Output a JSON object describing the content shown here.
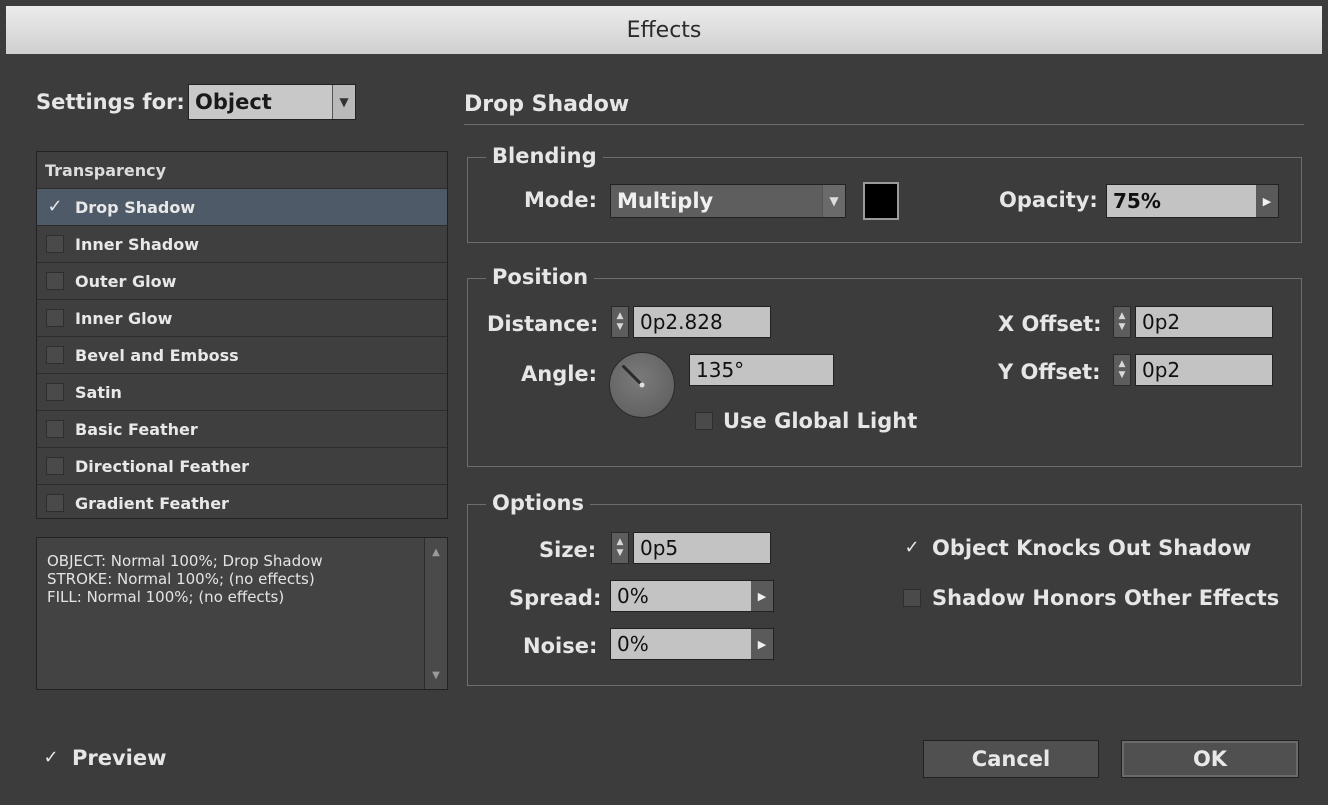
{
  "window": {
    "title": "Effects"
  },
  "settings_for": {
    "label": "Settings for:",
    "value": "Object"
  },
  "effects_list": {
    "header": "Transparency",
    "items": [
      {
        "label": "Drop Shadow",
        "checked": true,
        "selected": true
      },
      {
        "label": "Inner Shadow",
        "checked": false
      },
      {
        "label": "Outer Glow",
        "checked": false
      },
      {
        "label": "Inner Glow",
        "checked": false
      },
      {
        "label": "Bevel and Emboss",
        "checked": false
      },
      {
        "label": "Satin",
        "checked": false
      },
      {
        "label": "Basic Feather",
        "checked": false
      },
      {
        "label": "Directional Feather",
        "checked": false
      },
      {
        "label": "Gradient Feather",
        "checked": false
      }
    ]
  },
  "summary": {
    "lines": [
      "OBJECT: Normal 100%; Drop Shadow",
      "STROKE: Normal 100%; (no effects)",
      "FILL: Normal 100%; (no effects)"
    ]
  },
  "panel_title": "Drop Shadow",
  "blending": {
    "title": "Blending",
    "mode_label": "Mode:",
    "mode_value": "Multiply",
    "swatch_color": "#000000",
    "opacity_label": "Opacity:",
    "opacity_value": "75%"
  },
  "position": {
    "title": "Position",
    "distance_label": "Distance:",
    "distance_value": "0p2.828",
    "angle_label": "Angle:",
    "angle_value": "135°",
    "angle_degrees": 135,
    "use_global_light_label": "Use Global Light",
    "use_global_light_checked": false,
    "x_offset_label": "X Offset:",
    "x_offset_value": "0p2",
    "y_offset_label": "Y Offset:",
    "y_offset_value": "0p2"
  },
  "options": {
    "title": "Options",
    "size_label": "Size:",
    "size_value": "0p5",
    "spread_label": "Spread:",
    "spread_value": "0%",
    "noise_label": "Noise:",
    "noise_value": "0%",
    "knocks_out_label": "Object Knocks Out Shadow",
    "knocks_out_checked": true,
    "honors_label": "Shadow Honors Other Effects",
    "honors_checked": false
  },
  "footer": {
    "preview_label": "Preview",
    "preview_checked": true,
    "cancel_label": "Cancel",
    "ok_label": "OK"
  },
  "glyphs": {
    "check": "✓",
    "dropdown_arrow": "▼",
    "flyout_arrow": "▶",
    "step_up": "▲",
    "step_down": "▼",
    "scroll_up": "▲",
    "scroll_down": "▼"
  }
}
